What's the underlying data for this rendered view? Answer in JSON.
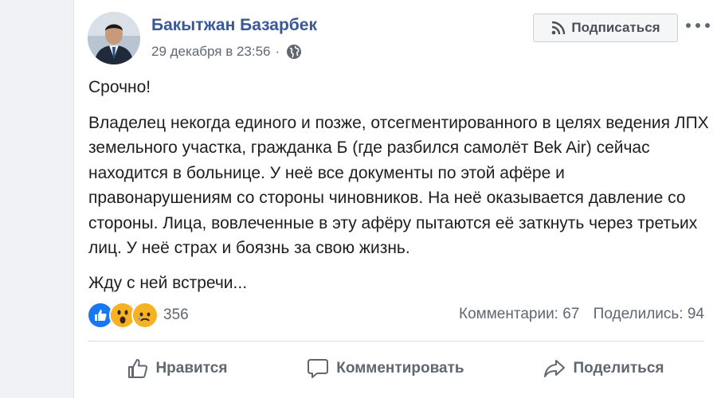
{
  "post": {
    "author": "Бакытжан Базарбек",
    "date": "29 декабря в 23:56",
    "separator": "·",
    "privacy_icon": "globe-icon",
    "subscribe_label": "Подписаться",
    "paragraphs": [
      "Срочно!",
      "Владелец некогда единого и позже, отсегментированного в целях ведения ЛПХ земельного участка, гражданка Б (где разбился самолёт Bek Air) сейчас находится в больнице. У неё все документы по этой афёре и правонарушениям со стороны чиновников. На неё оказывается давление со стороны. Лица, вовлеченные в эту афёру пытаются её заткнуть через третьих лиц. У неё страх и боязнь за свою жизнь.",
      "Жду с ней встречи..."
    ]
  },
  "reactions": {
    "types": [
      "like",
      "wow",
      "sad"
    ],
    "count": "356"
  },
  "stats": {
    "comments": "Комментарии: 67",
    "shares": "Поделились: 94"
  },
  "actions": {
    "like": "Нравится",
    "comment": "Комментировать",
    "share": "Поделиться"
  },
  "colors": {
    "author": "#385898",
    "like": "#1877f2",
    "emoji": "#f7b125",
    "muted": "#606770"
  }
}
